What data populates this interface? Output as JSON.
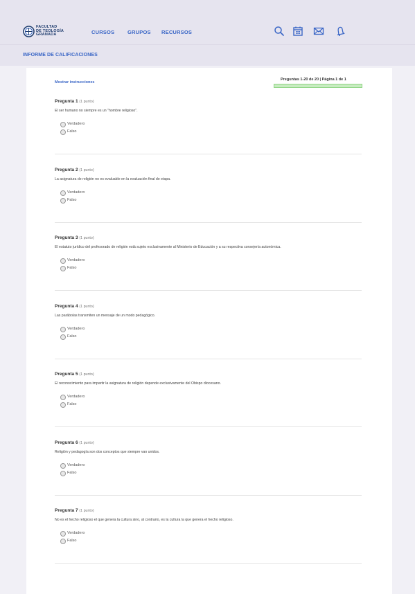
{
  "brand": {
    "logo_lines": [
      "FACULTAD",
      "DE TEOLOGÍA",
      "GRANADA"
    ]
  },
  "nav": {
    "cursos": "CURSOS",
    "grupos": "GRUPOS",
    "recursos": "RECURSOS"
  },
  "icons": [
    "search-icon",
    "calendar-icon",
    "mail-icon",
    "bell-icon"
  ],
  "colors": {
    "accent": "#3a66c6",
    "header_bg": "#e6e4ef",
    "progress": "#c7ecc0"
  },
  "report": {
    "title": "INFORME DE CALIFICACIONES",
    "show_instructions": "Mostrar instrucciones",
    "paging": "Preguntas 1-20 de 20 | Página 1 de 1"
  },
  "options": {
    "true_label": "Verdadero",
    "false_label": "Falso"
  },
  "questions": [
    {
      "title": "Pregunta 1",
      "points": "(1 punto)",
      "text": "El ser humano no siempre es un \"hombre religioso\"."
    },
    {
      "title": "Pregunta 2",
      "points": "(1 punto)",
      "text": "La asignatura de religión no es evaluable en la evaluación final de etapa."
    },
    {
      "title": "Pregunta 3",
      "points": "(1 punto)",
      "text": "El estatuto jurídico del profesorado de religión está sujeto exclusivamente al Ministerio de Educación y a su respectiva consejería autonómica."
    },
    {
      "title": "Pregunta 4",
      "points": "(1 punto)",
      "text": "Las parábolas transmiten un mensaje de un modo pedagógico."
    },
    {
      "title": "Pregunta 5",
      "points": "(1 punto)",
      "text": "El reconocimiento para impartir la asignatura de religión depende exclusivamente del Obispo diocesano."
    },
    {
      "title": "Pregunta 6",
      "points": "(1 punto)",
      "text": "Religión y pedagogía son dos conceptos que siempre van unidos."
    },
    {
      "title": "Pregunta 7",
      "points": "(1 punto)",
      "text": "No es el hecho religioso el que genera la cultura sino, al contrario, es la cultura la que genera el hecho religioso."
    }
  ]
}
